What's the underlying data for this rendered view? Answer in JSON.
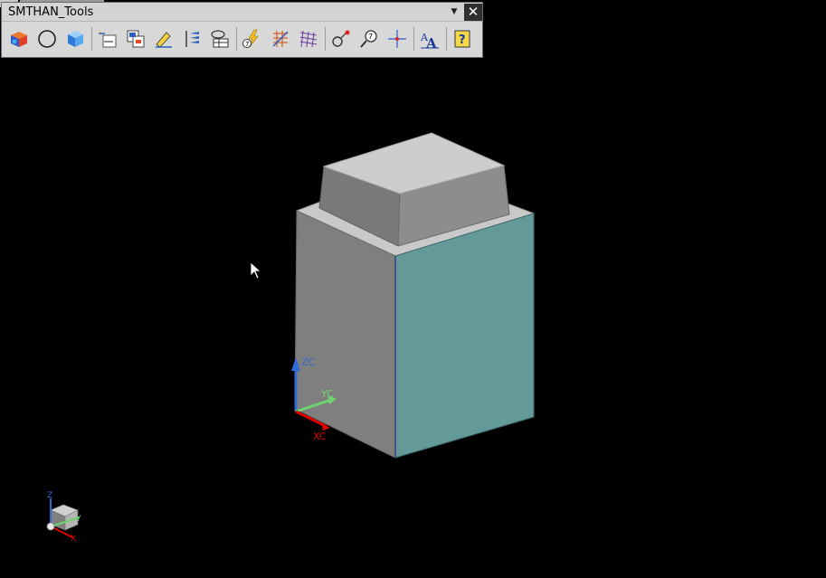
{
  "toolbar": {
    "title": "SMTHAN_Tools",
    "menu_icon": "dropdown-arrow-icon",
    "close_icon": "close-icon",
    "close_glyph": "✕",
    "menu_glyph": "▼",
    "icons": [
      "colored-block-icon",
      "circle-icon",
      "blue-cube-icon",
      "new-layer-icon",
      "copy-layers-icon",
      "pencil-tool-icon",
      "align-icon",
      "table-grid-icon",
      "lightning-number-icon",
      "grid-lines-icon",
      "mesh-grid-icon",
      "red-pin-icon",
      "magnify-number-icon",
      "crosshair-point-icon",
      "text-style-icon",
      "help-icon"
    ]
  },
  "viewport": {
    "background": "#000000",
    "wcs_labels": {
      "zc": "ZC",
      "yc": "YC",
      "xc": "XC"
    },
    "triad_labels": {
      "z": "Z",
      "y": "Y",
      "x": "X"
    },
    "colors": {
      "teal_face": "#64999a",
      "gray_face": "#808080",
      "top_face": "#c8c8c8",
      "xc": "#e00000",
      "yc": "#6dd46d",
      "zc": "#2f6cd8"
    }
  }
}
